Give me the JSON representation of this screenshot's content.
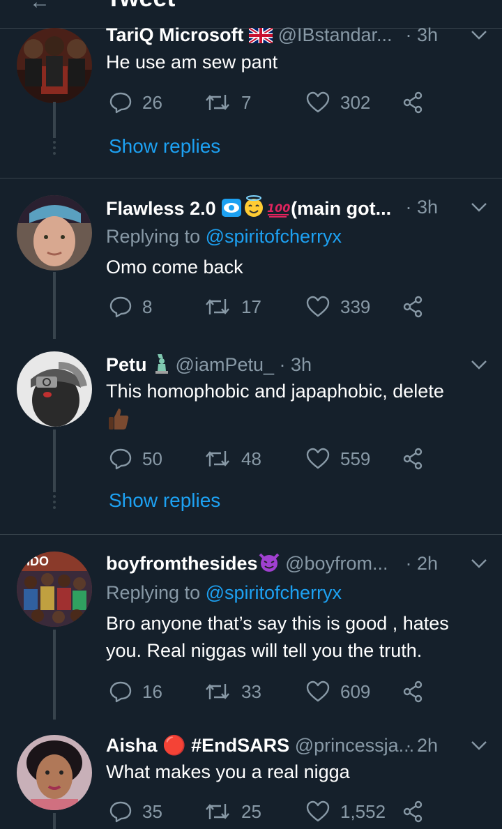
{
  "page": {
    "title": "Tweet"
  },
  "tweets": [
    {
      "name": "TariQ Microsoft",
      "handle": "@IBstandar...",
      "time": "· 3h",
      "text": "He use am sew pant",
      "replies": "26",
      "retweets": "7",
      "likes": "302",
      "show_replies": "Show replies"
    },
    {
      "name": "Flawless 2.0",
      "name_suffix": "(main got...",
      "time": "· 3h",
      "replying_prefix": "Replying to",
      "replying_handle": "@spiritofcherryx",
      "text": "Omo come back",
      "replies": "8",
      "retweets": "17",
      "likes": "339"
    },
    {
      "name": "Petu",
      "handle": "@iamPetu_",
      "time": "· 3h",
      "text": "This homophobic and japaphobic, delete",
      "replies": "50",
      "retweets": "48",
      "likes": "559",
      "show_replies": "Show replies"
    },
    {
      "name": "boyfromthesides",
      "handle": "@boyfrom...",
      "time": "· 2h",
      "replying_prefix": "Replying to",
      "replying_handle": "@spiritofcherryx",
      "text": "Bro anyone that’s say this is good , hates you. Real niggas will tell you the truth.",
      "replies": "16",
      "retweets": "33",
      "likes": "609",
      "avatar_text": "VIDO"
    },
    {
      "name": "Aisha 🔴 #EndSARS",
      "handle": "@princessja...",
      "time": "· 2h",
      "text": "What makes you a real nigga",
      "replies": "35",
      "retweets": "25",
      "likes": "1,552"
    }
  ],
  "colors": {
    "background": "#15202b",
    "divider": "#38444d",
    "secondary_text": "#8899a6",
    "link": "#1da1f2"
  },
  "icons": [
    "reply-icon",
    "retweet-icon",
    "like-icon",
    "share-icon",
    "caret-down-icon",
    "uk-flag-icon",
    "statue-of-liberty-icon",
    "thumbs-up-icon",
    "devil-emoji-icon",
    "eye-emoji-icon",
    "halo-emoji-icon",
    "hundred-emoji-icon"
  ]
}
